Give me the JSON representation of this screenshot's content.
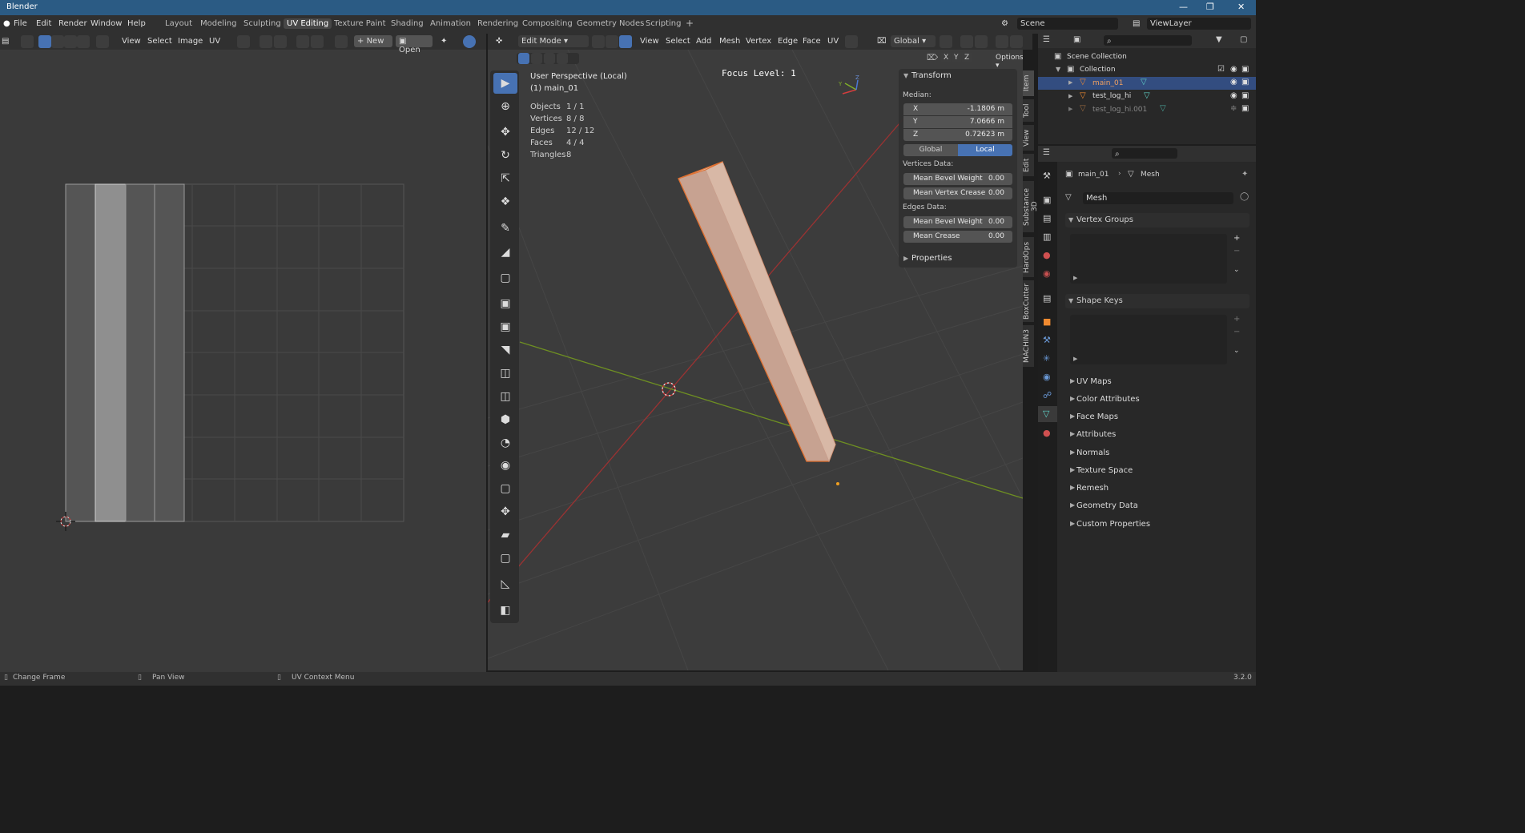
{
  "app_title": "Blender",
  "menus": [
    "File",
    "Edit",
    "Render",
    "Window",
    "Help"
  ],
  "workspaces": [
    "Layout",
    "Modeling",
    "Sculpting",
    "UV Editing",
    "Texture Paint",
    "Shading",
    "Animation",
    "Rendering",
    "Compositing",
    "Geometry Nodes",
    "Scripting"
  ],
  "active_workspace": "UV Editing",
  "scene": {
    "label": "Scene"
  },
  "view_layer": {
    "label": "ViewLayer"
  },
  "uv_editor": {
    "menus": [
      "View",
      "Select",
      "Image",
      "UV"
    ],
    "new_label": "New",
    "open_label": "Open"
  },
  "viewport": {
    "mode": "Edit Mode",
    "menus": [
      "View",
      "Select",
      "Add",
      "Mesh",
      "Vertex",
      "Edge",
      "Face",
      "UV"
    ],
    "orientation": "Global",
    "options_label": "Options",
    "axes": [
      "X",
      "Y",
      "Z"
    ],
    "perspective": "User Perspective (Local)",
    "object_line": "(1) main_01",
    "focus_level": "Focus Level: 1",
    "stats": [
      {
        "label": "Objects",
        "value": "1 / 1"
      },
      {
        "label": "Vertices",
        "value": "8 / 8"
      },
      {
        "label": "Edges",
        "value": "12 / 12"
      },
      {
        "label": "Faces",
        "value": "4 / 4"
      },
      {
        "label": "Triangles",
        "value": "8"
      }
    ],
    "gizmo_labels": {
      "x": "X",
      "y": "Y",
      "z": "Z"
    }
  },
  "transform_panel": {
    "title": "Transform",
    "median_label": "Median:",
    "x": {
      "label": "X",
      "value": "-1.1806 m"
    },
    "y": {
      "label": "Y",
      "value": "7.0666 m"
    },
    "z": {
      "label": "Z",
      "value": "0.72623 m"
    },
    "global_label": "Global",
    "local_label": "Local",
    "vertices_data_label": "Vertices Data:",
    "mean_bevel_weight": {
      "label": "Mean Bevel Weight",
      "value": "0.00"
    },
    "mean_vertex_crease": {
      "label": "Mean Vertex Crease",
      "value": "0.00"
    },
    "edges_data_label": "Edges Data:",
    "edge_bevel_weight": {
      "label": "Mean Bevel Weight",
      "value": "0.00"
    },
    "mean_crease": {
      "label": "Mean Crease",
      "value": "0.00"
    },
    "properties_label": "Properties"
  },
  "side_tabs": [
    "Item",
    "Tool",
    "View",
    "Edit",
    "Substance 3D",
    "HardOps",
    "BoxCutter",
    "MACHIN3"
  ],
  "outliner": {
    "scene_collection": "Scene Collection",
    "collection": "Collection",
    "objects": [
      "main_01",
      "test_log_hi",
      "test_log_hi.001"
    ]
  },
  "properties": {
    "breadcrumb_object": "main_01",
    "breadcrumb_data": "Mesh",
    "mesh_name": "Mesh",
    "open_sections": [
      "Vertex Groups",
      "Shape Keys"
    ],
    "closed_sections": [
      "UV Maps",
      "Color Attributes",
      "Face Maps",
      "Attributes",
      "Normals",
      "Texture Space",
      "Remesh",
      "Geometry Data",
      "Custom Properties"
    ]
  },
  "statusbar": {
    "items": [
      "Change Frame",
      "Pan View",
      "UV Context Menu"
    ],
    "version": "3.2.0"
  },
  "colors": {
    "accent": "#4772b3",
    "title_bar": "#2b5b84",
    "x_axis": "#d43d3d",
    "y_axis": "#7fae28",
    "selection_orange": "#f07b24"
  }
}
